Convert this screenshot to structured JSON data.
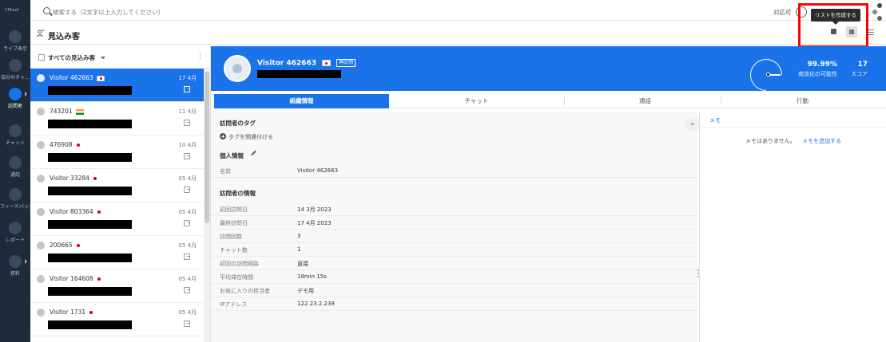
{
  "nav": {
    "logo": "CPbeet",
    "items": [
      {
        "label": "",
        "icon": "at-icon",
        "active": false
      },
      {
        "label": "ライブ表示",
        "icon": "live-icon",
        "active": false
      },
      {
        "label": "自分のチャ...",
        "icon": "chat-bubble-icon",
        "active": false
      },
      {
        "label": "訪問者",
        "icon": "visitor-icon",
        "active": true
      },
      {
        "label": "チャット",
        "icon": "chat-icon",
        "active": false
      },
      {
        "label": "通話",
        "icon": "phone-icon",
        "active": false
      },
      {
        "label": "フィードバック",
        "icon": "star-icon",
        "active": false
      },
      {
        "label": "レポート",
        "icon": "chart-icon",
        "active": false
      },
      {
        "label": "資料",
        "icon": "document-icon",
        "active": false
      }
    ]
  },
  "search": {
    "placeholder": "検索する（2文字以上入力してください）"
  },
  "availability": {
    "label": "対応可"
  },
  "page": {
    "title": "見込み客",
    "tooltip": "リストを作成する"
  },
  "list": {
    "filter": "すべての見込み客",
    "visitors": [
      {
        "name": "Visitor 462663",
        "marker": "jp",
        "date": "17 4月",
        "selected": true
      },
      {
        "name": "743201",
        "marker": "in",
        "date": "11 4月",
        "selected": false
      },
      {
        "name": "476908",
        "marker": "dot",
        "date": "10 4月",
        "selected": false
      },
      {
        "name": "Visitor 33284",
        "marker": "dot",
        "date": "05 4月",
        "selected": false
      },
      {
        "name": "Visitor 803364",
        "marker": "dot",
        "date": "05 4月",
        "selected": false
      },
      {
        "name": "200665",
        "marker": "dot",
        "date": "05 4月",
        "selected": false
      },
      {
        "name": "Visitor 164608",
        "marker": "dot",
        "date": "05 4月",
        "selected": false
      },
      {
        "name": "Visitor 1731",
        "marker": "dot",
        "date": "05 4月",
        "selected": false
      }
    ]
  },
  "detail": {
    "name": "Visitor 462663",
    "revisit": "再訪問",
    "probability": "99.99%",
    "probability_value": 99.99,
    "probability_label": "商談化の可能性",
    "score": "17",
    "score_label": "スコア",
    "tabs": [
      {
        "label": "組織情報",
        "active": true
      },
      {
        "label": "チャット",
        "active": false
      },
      {
        "label": "通話",
        "active": false
      },
      {
        "label": "行動",
        "active": false
      }
    ],
    "tags_title": "訪問者のタグ",
    "add_tag": "タグを関連付ける",
    "personal_title": "個人情報",
    "name_row": {
      "label": "名前",
      "value": "Visitor 462663"
    },
    "visitor_info_title": "訪問者の情報",
    "rows": [
      {
        "label": "初回訪問日",
        "value": "14 3月 2023"
      },
      {
        "label": "最終訪問日",
        "value": "17 4月 2023"
      },
      {
        "label": "訪問回数",
        "value": "3"
      },
      {
        "label": "チャット数",
        "value": "1"
      },
      {
        "label": "初回の訪問経路",
        "value": "直接"
      },
      {
        "label": "平均滞在時間",
        "value": "18min 15s"
      },
      {
        "label": "お気に入りの担当者",
        "value": "デモ用"
      },
      {
        "label": "IPアドレス",
        "value": "122.23.2.239"
      }
    ]
  },
  "memo": {
    "tab_label": "メモ",
    "empty_text": "メモはありません。",
    "add_link": "メモを追加する"
  },
  "colors": {
    "accent": "#1a73e8",
    "nav_bg": "#1f2a3a",
    "highlight": "#ff0000"
  }
}
